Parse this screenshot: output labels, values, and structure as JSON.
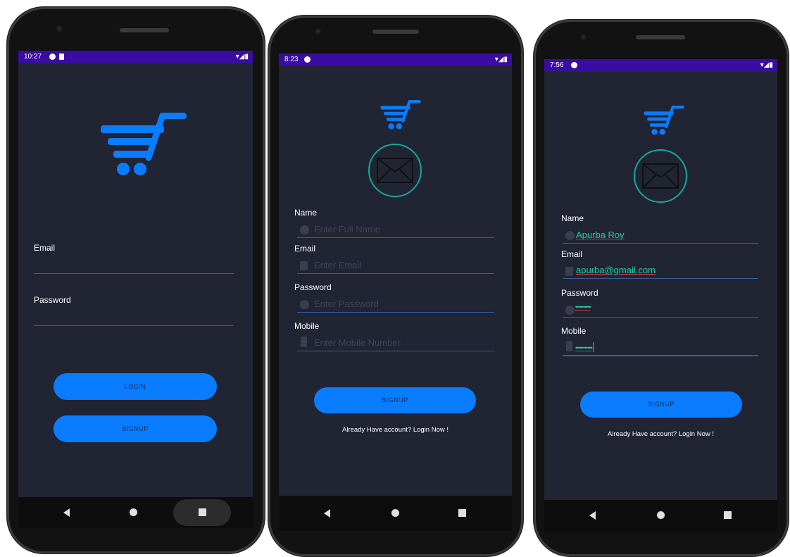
{
  "colors": {
    "screen_bg": "#212433",
    "status_bar": "#3a0ca3",
    "accent_blue": "#0a7cff",
    "field_line": "#2f5fa8",
    "filled_text": "#18d3a0",
    "mail_ring": "#15a89a"
  },
  "login_screen": {
    "status_time": "10:27",
    "email_label": "Email",
    "password_label": "Password",
    "login_button": "LOGIN",
    "signup_button": "SIGNUP"
  },
  "signup_empty_screen": {
    "status_time": "8:23",
    "name_label": "Name",
    "name_placeholder": "Enter Full Name",
    "email_label": "Email",
    "email_placeholder": "Enter Email",
    "password_label": "Password",
    "password_placeholder": "Enter Password",
    "mobile_label": "Mobile",
    "mobile_placeholder": "Enter Mobile Number",
    "signup_button": "SIGNUP",
    "login_link": "Already Have account? Login Now !"
  },
  "signup_filled_screen": {
    "status_time": "7:56",
    "name_label": "Name",
    "name_value": "Apurba Roy",
    "email_label": "Email",
    "email_value": "apurba@gmail.com",
    "password_label": "Password",
    "password_value": "••••••••••",
    "mobile_label": "Mobile",
    "mobile_value": "•••••••••••",
    "signup_button": "SIGNUP",
    "login_link": "Already Have account? Login Now !"
  },
  "icons": {
    "logo": "shopping-cart-icon",
    "mail": "envelope-icon",
    "name_field": "person-icon",
    "email_field": "mail-icon",
    "password_field": "lock-icon",
    "mobile_field": "phone-icon"
  }
}
